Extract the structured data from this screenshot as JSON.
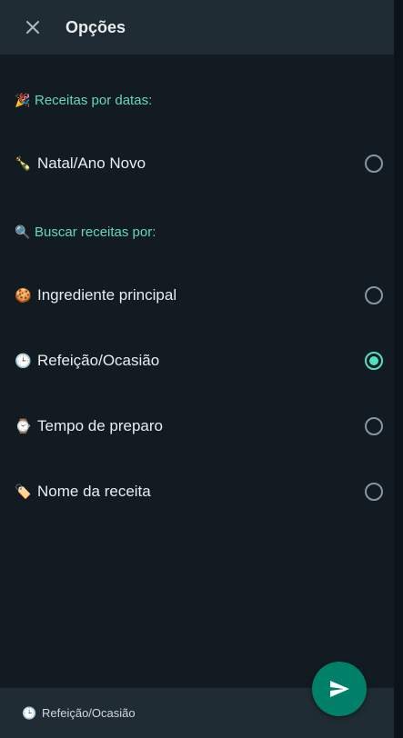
{
  "header": {
    "title": "Opções",
    "close_icon": "close-icon"
  },
  "sections": [
    {
      "title": "Receitas por datas:",
      "emoji": "🎉",
      "options": [
        {
          "label": "Natal/Ano Novo",
          "emoji": "🍾",
          "selected": false
        }
      ]
    },
    {
      "title": "Buscar receitas por:",
      "emoji": "🔍",
      "options": [
        {
          "label": "Ingrediente principal",
          "emoji": "🍪",
          "selected": false
        },
        {
          "label": "Refeição/Ocasião",
          "emoji": "🕒",
          "selected": true
        },
        {
          "label": "Tempo de preparo",
          "emoji": "⌚",
          "selected": false
        },
        {
          "label": "Nome da receita",
          "emoji": "🏷️",
          "selected": false
        }
      ]
    }
  ],
  "footer": {
    "emoji": "🕒",
    "selection_label": "Refeição/Ocasião"
  },
  "send_button": {
    "icon": "send-icon"
  },
  "colors": {
    "header_bg": "#202c33",
    "panel_bg": "#111b21",
    "accent": "#53e0c1",
    "section_title": "#64d8b4",
    "fab": "#008069"
  }
}
